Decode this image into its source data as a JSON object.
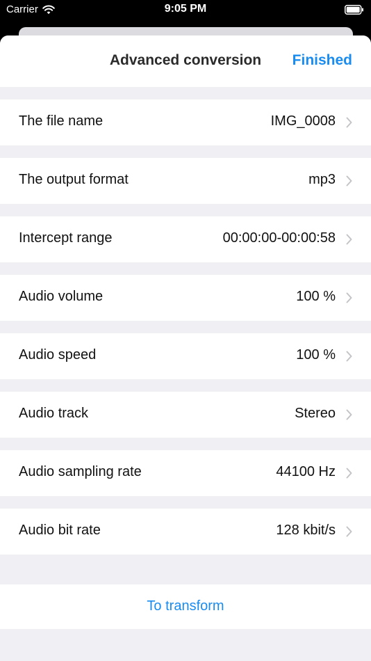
{
  "status_bar": {
    "carrier": "Carrier",
    "time": "9:05 PM"
  },
  "nav": {
    "title": "Advanced conversion",
    "finished_label": "Finished"
  },
  "settings": [
    {
      "label": "The file name",
      "value": "IMG_0008"
    },
    {
      "label": "The output format",
      "value": "mp3"
    },
    {
      "label": "Intercept range",
      "value": "00:00:00-00:00:58"
    },
    {
      "label": "Audio volume",
      "value": "100 %"
    },
    {
      "label": "Audio speed",
      "value": "100 %"
    },
    {
      "label": "Audio track",
      "value": "Stereo"
    },
    {
      "label": "Audio sampling rate",
      "value": "44100 Hz"
    },
    {
      "label": "Audio bit rate",
      "value": "128 kbit/s"
    }
  ],
  "action": {
    "transform_label": "To transform"
  },
  "colors": {
    "accent": "#1a8cf0",
    "background": "#efeff4",
    "chevron": "#c4c4c8"
  },
  "icons": {
    "wifi": "wifi-icon",
    "battery": "battery-icon",
    "chevron": "chevron-right-icon"
  }
}
